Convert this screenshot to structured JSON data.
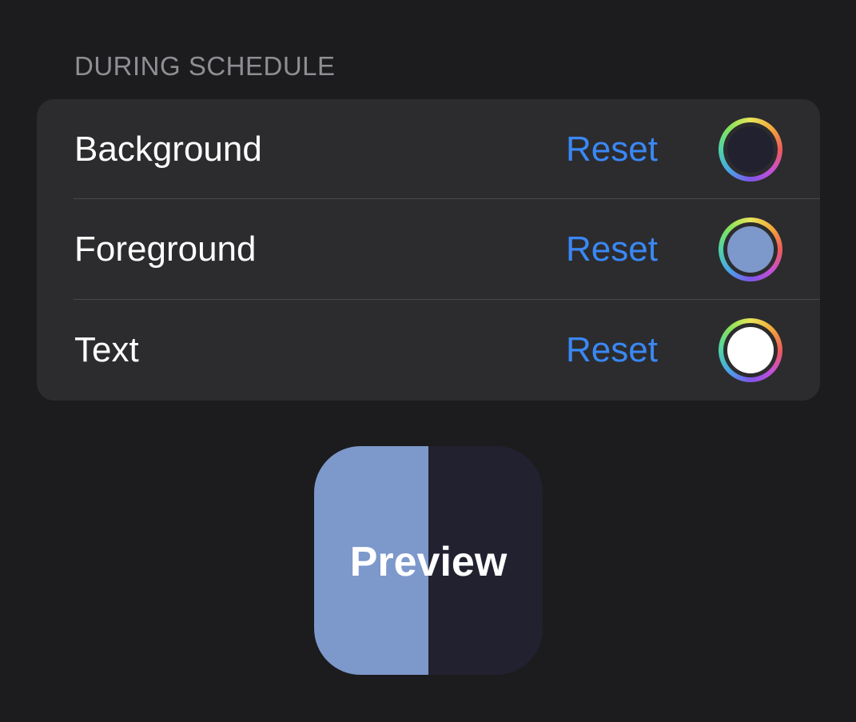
{
  "section": {
    "header": "DURING SCHEDULE"
  },
  "rows": [
    {
      "label": "Background",
      "reset_label": "Reset",
      "color": "#22212f"
    },
    {
      "label": "Foreground",
      "reset_label": "Reset",
      "color": "#7d98cb"
    },
    {
      "label": "Text",
      "reset_label": "Reset",
      "color": "#ffffff"
    }
  ],
  "preview": {
    "label": "Preview",
    "foreground_color": "#7d98cb",
    "background_color": "#22212f",
    "text_color": "#ffffff"
  },
  "colors": {
    "page_background": "#1c1c1e",
    "group_background": "#2c2c2e",
    "accent": "#3a88f5",
    "section_header": "#8e8e93"
  }
}
